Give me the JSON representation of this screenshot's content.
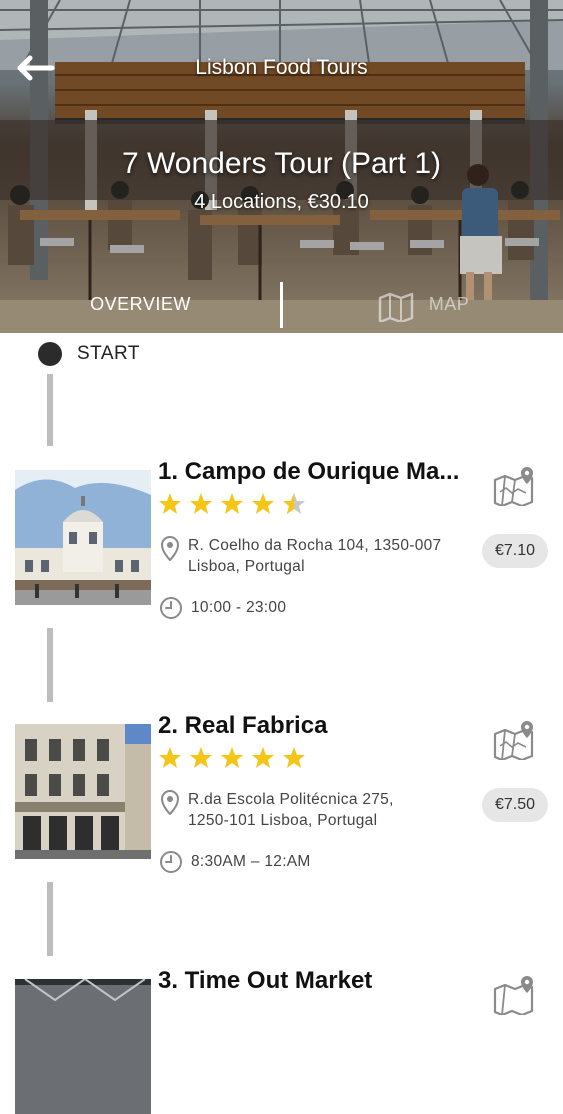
{
  "header": {
    "title": "Lisbon Food Tours",
    "back_icon": "back-arrow-icon"
  },
  "tour": {
    "name": "7 Wonders Tour (Part 1)",
    "meta": "4 Locations, €30.10"
  },
  "tabs": [
    {
      "label": "OVERVIEW",
      "selected": true
    },
    {
      "label": "MAP",
      "icon": "map-icon",
      "selected": false
    }
  ],
  "timeline": {
    "start_label": "START"
  },
  "stops": [
    {
      "title": "1. Campo de Ourique Ma...",
      "rating": 4.5,
      "address_line1": "R. Coelho da Rocha 104, 1350-007",
      "address_line2": "Lisboa, Portugal",
      "hours": "10:00 - 23:00",
      "price": "€7.10"
    },
    {
      "title": "2. Real Fabrica",
      "rating": 5,
      "address_line1": "R.da Escola Politécnica 275,",
      "address_line2": "1250-101 Lisboa, Portugal",
      "hours": "8:30AM – 12:AM",
      "price": "€7.50"
    },
    {
      "title": "3. Time Out Market"
    }
  ],
  "colors": {
    "star": "#f5c518",
    "star_empty": "#c8c8c8",
    "timeline": "#bdbdbd",
    "price_bg": "#e6e6e6",
    "icon_gray": "#8a8a8a"
  }
}
